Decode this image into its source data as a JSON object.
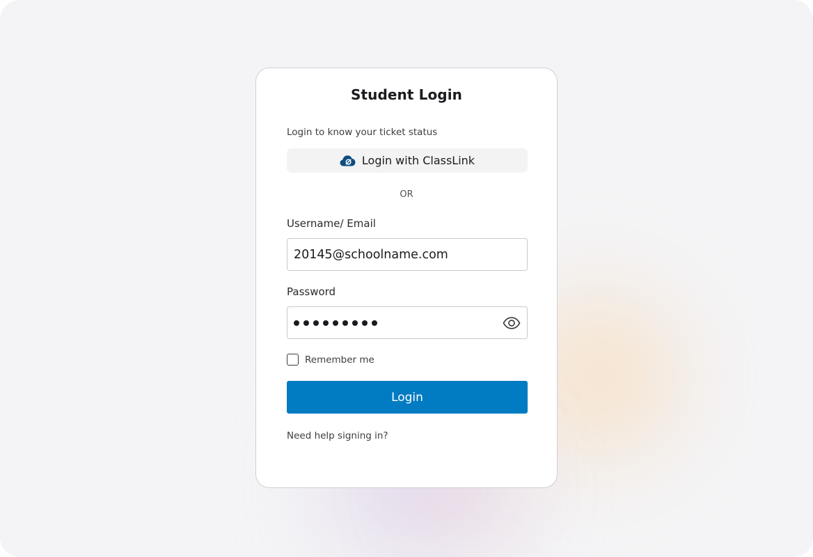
{
  "login": {
    "title": "Student Login",
    "subtitle": "Login to know your ticket status",
    "sso_label": "Login with ClassLink",
    "divider": "OR",
    "username": {
      "label": "Username/ Email",
      "value": "20145@schoolname.com"
    },
    "password": {
      "label": "Password",
      "masked_length": 9,
      "icon": "eye-icon"
    },
    "remember_label": "Remember me",
    "remember_checked": false,
    "submit_label": "Login",
    "help_link": "Need help signing in?"
  },
  "colors": {
    "primary": "#017bc1",
    "classlink_icon": "#0f4c81",
    "background": "#f4f4f6"
  }
}
